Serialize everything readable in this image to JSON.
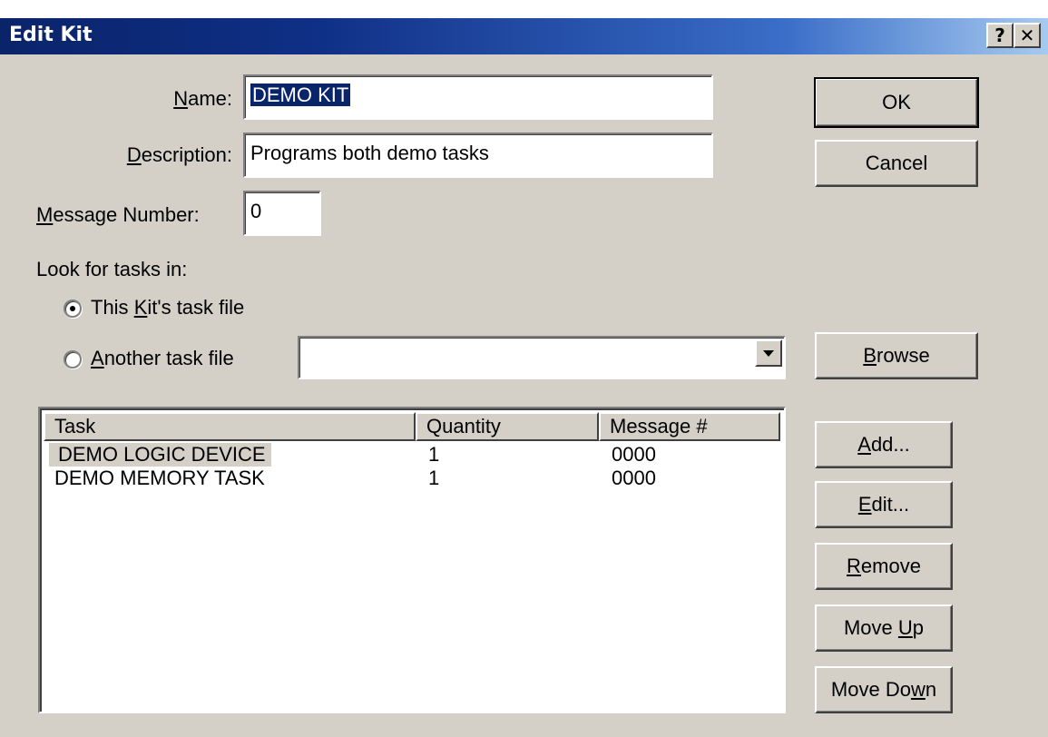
{
  "window": {
    "title": "Edit Kit",
    "help_button": "?",
    "close_button": "✕"
  },
  "form": {
    "name_label": {
      "pre": "",
      "key": "N",
      "post": "ame:"
    },
    "name_value": "DEMO KIT",
    "description_label": {
      "pre": "",
      "key": "D",
      "post": "escription:"
    },
    "description_value": "Programs both demo tasks",
    "message_label": {
      "pre": "",
      "key": "M",
      "post": "essage Number:"
    },
    "message_value": "0",
    "look_for_label": "Look for tasks in:",
    "radio_this": {
      "pre": "This ",
      "key": "K",
      "post": "it's task file",
      "selected": true
    },
    "radio_another": {
      "pre": "",
      "key": "A",
      "post": "nother task file",
      "selected": false
    },
    "another_file_value": ""
  },
  "buttons": {
    "ok": "OK",
    "cancel": "Cancel",
    "browse": {
      "pre": "",
      "key": "B",
      "post": "rowse"
    },
    "add": {
      "pre": "",
      "key": "A",
      "post": "dd..."
    },
    "edit": {
      "pre": "",
      "key": "E",
      "post": "dit..."
    },
    "remove": {
      "pre": "",
      "key": "R",
      "post": "emove"
    },
    "move_up": {
      "pre": "Move ",
      "key": "U",
      "post": "p"
    },
    "move_down": {
      "pre": "Move Do",
      "key": "w",
      "post": "n"
    }
  },
  "table": {
    "columns": [
      "Task",
      "Quantity",
      "Message #"
    ],
    "rows": [
      {
        "task": "DEMO LOGIC DEVICE",
        "quantity": "1",
        "message": "0000",
        "selected": true
      },
      {
        "task": "DEMO MEMORY TASK",
        "quantity": "1",
        "message": "0000",
        "selected": false
      }
    ]
  },
  "colors": {
    "title_bar_start": "#0a246a",
    "title_bar_end": "#a6caf0",
    "dialog_face": "#d4d0c8",
    "selection": "#0a246a"
  }
}
